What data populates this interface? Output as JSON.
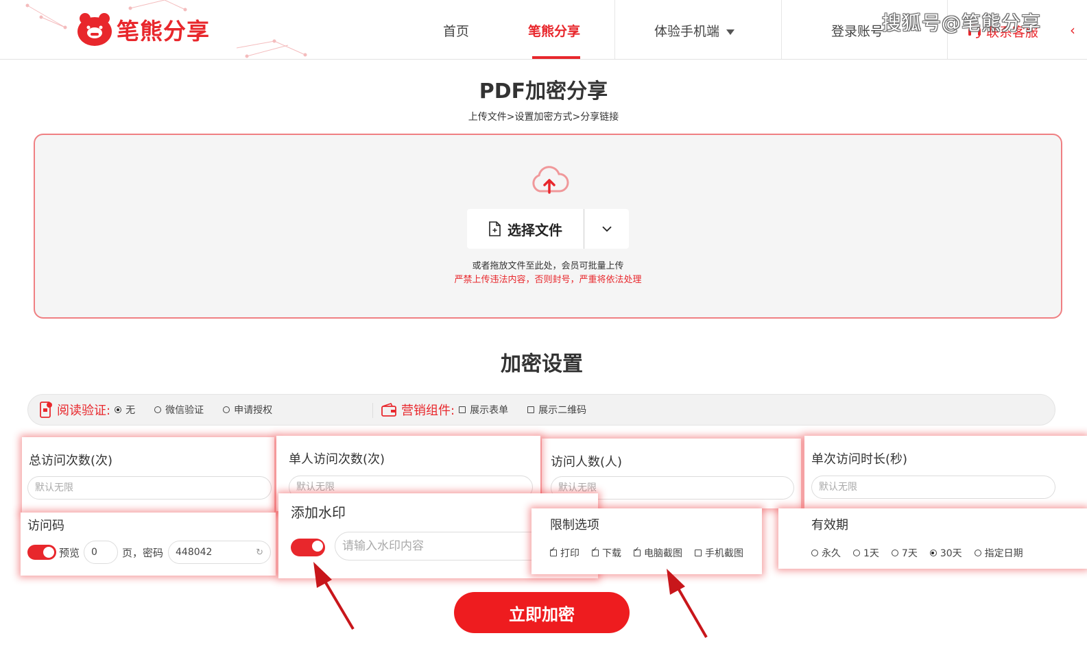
{
  "header": {
    "logo_text": "笔熊分享",
    "nav": [
      {
        "label": "首页",
        "active": false
      },
      {
        "label": "笔熊分享",
        "active": true
      },
      {
        "label": "体验手机端",
        "active": false
      },
      {
        "label": "登录账号",
        "active": false
      }
    ],
    "contact_label": "联系客服",
    "watermark": "搜狐号@笔熊分享"
  },
  "page": {
    "title": "PDF加密分享",
    "steps": "上传文件>设置加密方式>分享链接"
  },
  "upload": {
    "icon": "cloud-upload-icon",
    "button_label": "选择文件",
    "hint": "或者拖放文件至此处，会员可批量上传",
    "warning": "严禁上传违法内容，否则封号，严重将依法处理"
  },
  "settings": {
    "title": "加密设置",
    "verify_label": "阅读验证:",
    "verify_options": [
      {
        "label": "无",
        "selected": true
      },
      {
        "label": "微信验证",
        "selected": false
      },
      {
        "label": "申请授权",
        "selected": false
      }
    ],
    "marketing_label": "营销组件:",
    "marketing_options": [
      {
        "label": "展示表单",
        "checked": false
      },
      {
        "label": "展示二维码",
        "checked": false
      }
    ],
    "total_visits": {
      "label": "总访问次数(次)",
      "placeholder": "默认无限"
    },
    "per_user_visits": {
      "label": "单人访问次数(次)",
      "placeholder": "默认无限"
    },
    "visitors": {
      "label": "访问人数(人)",
      "placeholder": "默认无限"
    },
    "duration": {
      "label": "单次访问时长(秒)",
      "placeholder": "默认无限"
    },
    "access_code": {
      "label": "访问码",
      "preview_label": "预览",
      "pages_value": "0",
      "page_unit": "页，",
      "password_label": "密码",
      "password_value": "448042"
    },
    "watermark": {
      "label": "添加水印",
      "placeholder": "请输入水印内容"
    },
    "restrictions": {
      "label": "限制选项",
      "options": [
        {
          "label": "打印",
          "checked": true
        },
        {
          "label": "下载",
          "checked": true
        },
        {
          "label": "电脑截图",
          "checked": true
        },
        {
          "label": "手机截图",
          "checked": false
        }
      ]
    },
    "validity": {
      "label": "有效期",
      "options": [
        {
          "label": "永久",
          "selected": false
        },
        {
          "label": "1天",
          "selected": false
        },
        {
          "label": "7天",
          "selected": false
        },
        {
          "label": "30天",
          "selected": true
        },
        {
          "label": "指定日期",
          "selected": false
        }
      ]
    },
    "submit_label": "立即加密"
  },
  "colors": {
    "brand": "#e8272c",
    "border": "#ef7f82"
  }
}
